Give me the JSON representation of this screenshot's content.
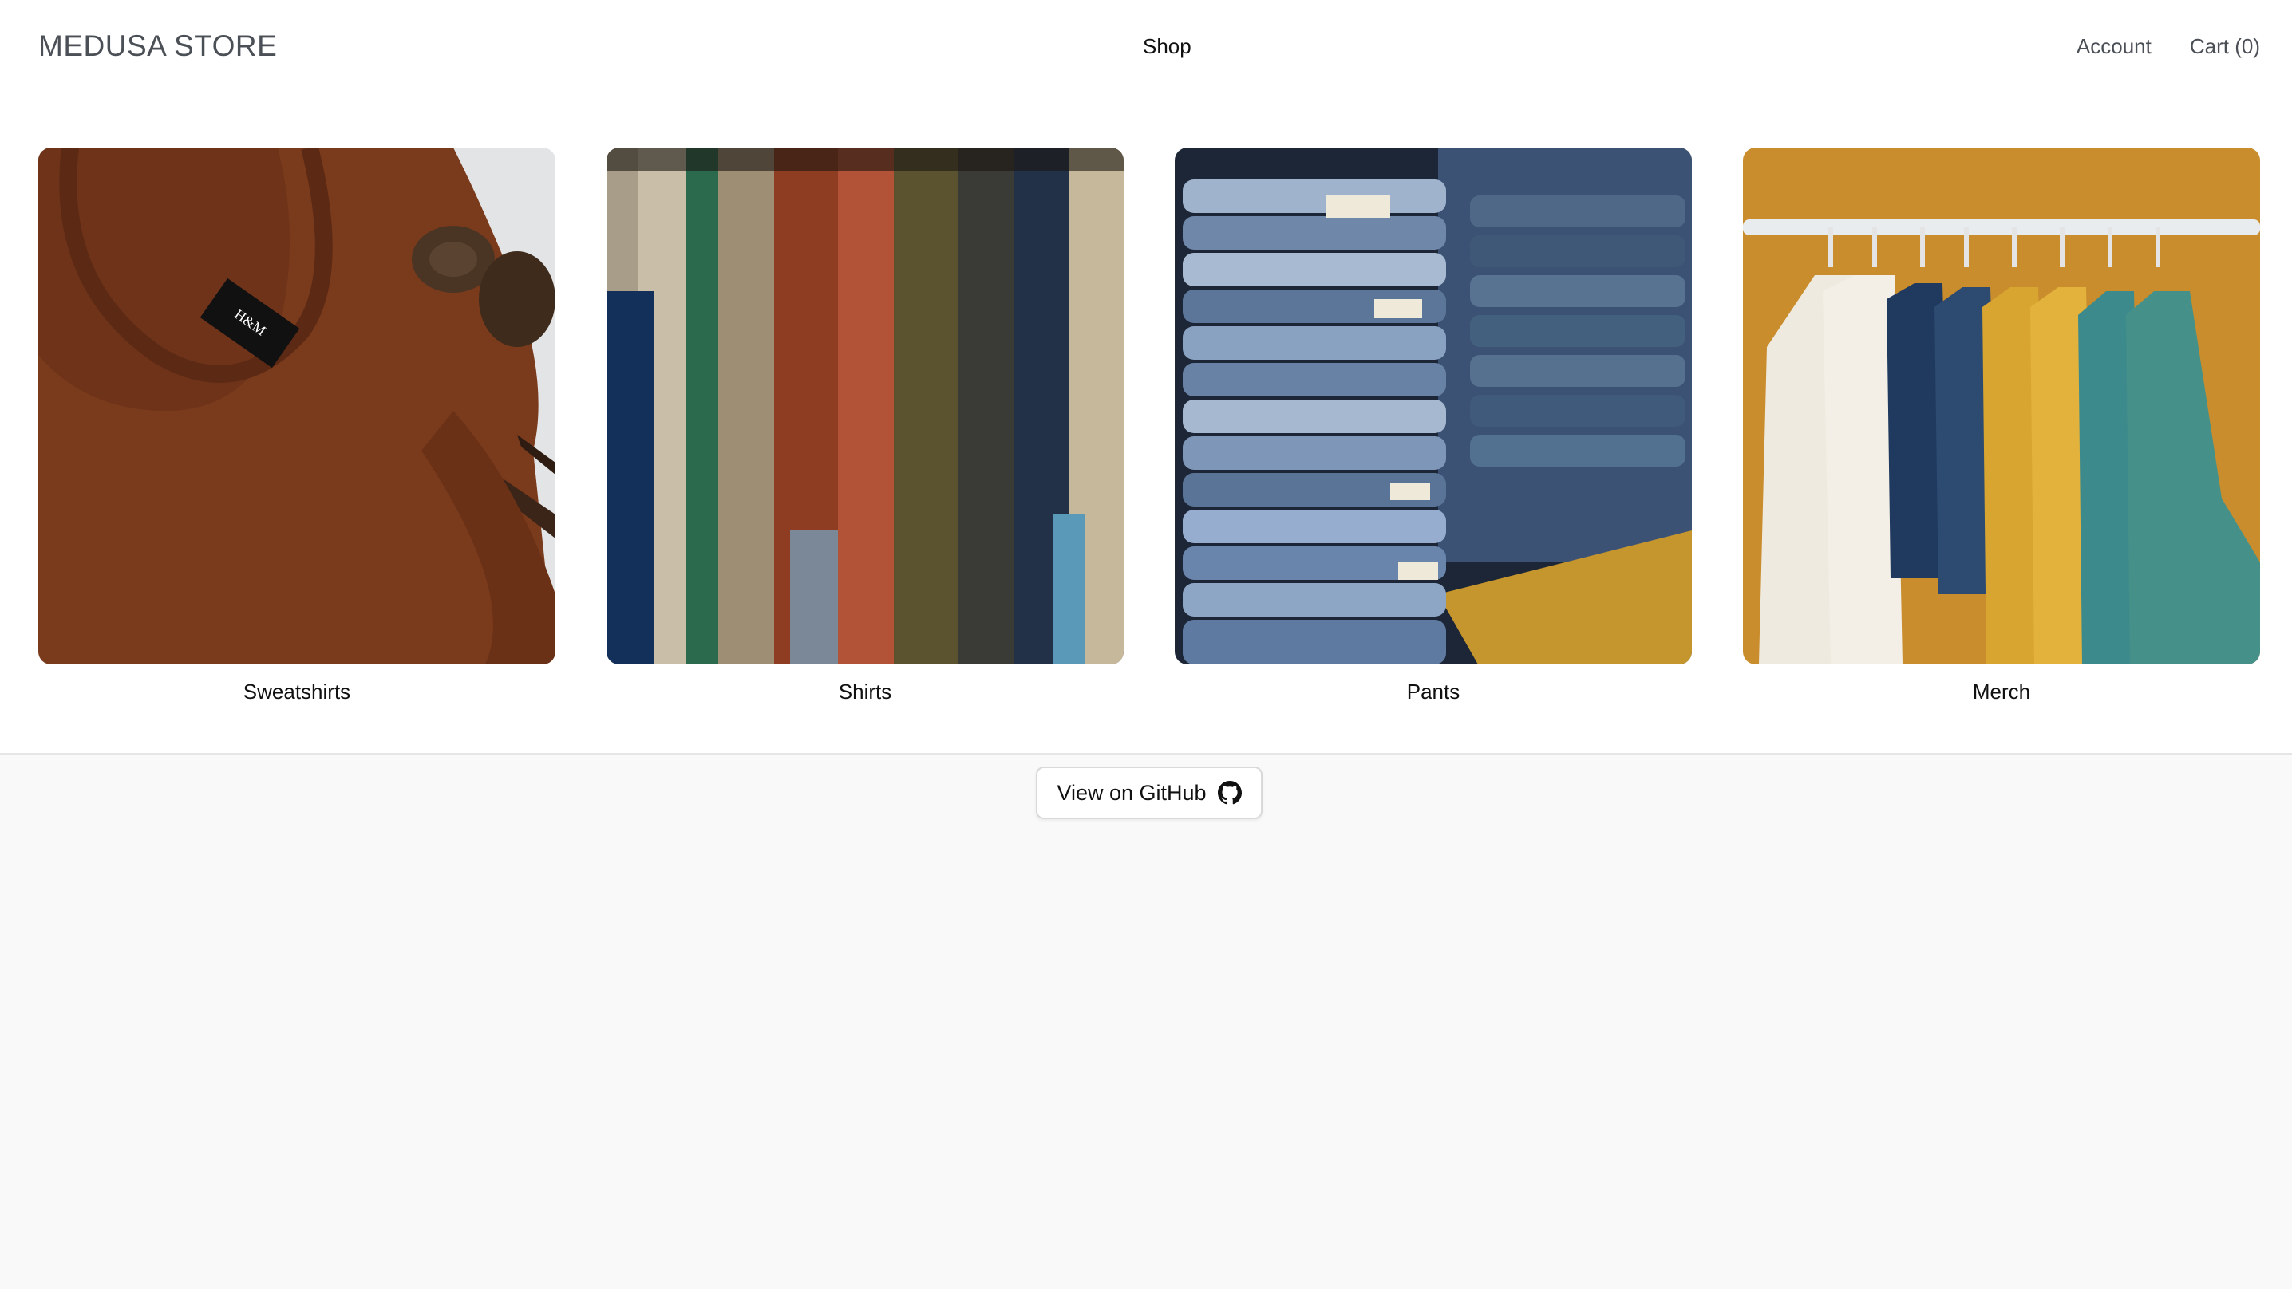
{
  "header": {
    "brand": "MEDUSA STORE",
    "nav": {
      "shop": "Shop"
    },
    "account": "Account",
    "cart": "Cart (0)"
  },
  "categories": [
    {
      "label": "Sweatshirts",
      "image": "sweatshirt-photo"
    },
    {
      "label": "Shirts",
      "image": "shirts-rack-photo"
    },
    {
      "label": "Pants",
      "image": "jeans-stack-photo"
    },
    {
      "label": "Merch",
      "image": "hanging-tees-photo"
    }
  ],
  "footer": {
    "github_button": "View on GitHub",
    "github_icon": "github-icon"
  },
  "colors": {
    "background": "#ffffff",
    "footer_background": "#f9f9f9",
    "text": "#111111",
    "muted_text": "#4b4f56"
  }
}
